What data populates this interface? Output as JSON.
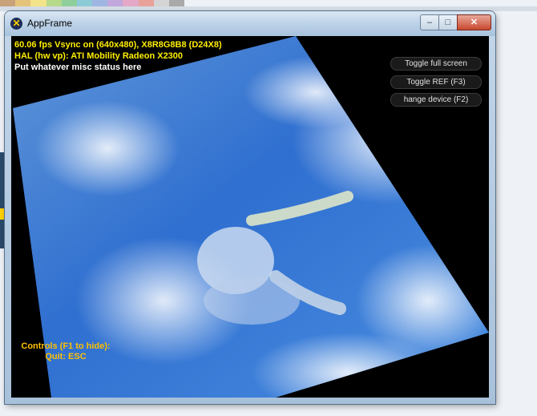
{
  "window": {
    "title": "AppFrame"
  },
  "window_controls": {
    "minimize": "–",
    "maximize": "□",
    "close": "✕"
  },
  "status": {
    "line1": "60.06 fps Vsync on (640x480), X8R8G8B8 (D24X8)",
    "line2": "HAL (hw vp): ATI Mobility Radeon X2300",
    "line3": "Put whatever misc status here"
  },
  "buttons": {
    "toggle_full_screen": "Toggle full screen",
    "toggle_ref": "Toggle REF (F3)",
    "change_device": "hange device (F2)"
  },
  "controls": {
    "line1": "Controls (F1 to hide):",
    "line2": "Quit: ESC"
  },
  "colors": {
    "status_yellow": "#ffee00",
    "controls_orange": "#ffc000",
    "viewport_bg": "#000000"
  }
}
